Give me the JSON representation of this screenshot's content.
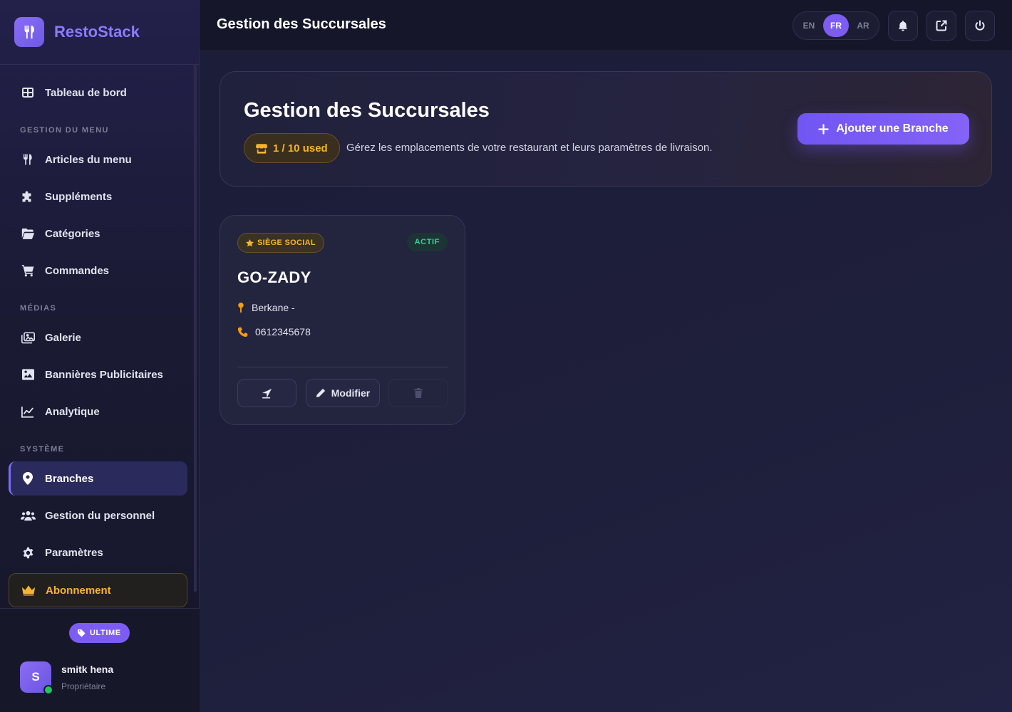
{
  "brand": {
    "name": "RestoStack",
    "icon": "utensils-icon"
  },
  "colors": {
    "accent": "#7c5cf3",
    "warning": "#f5b531",
    "success": "#2fd39a",
    "background": "#1c1d35"
  },
  "sidebar": {
    "dashboard": "Tableau de bord",
    "sections": {
      "menu": "GESTION DU MENU",
      "media": "MÉDIAS",
      "system": "SYSTÈME"
    },
    "items": {
      "menu_items": "Articles du menu",
      "supplements": "Suppléments",
      "categories": "Catégories",
      "orders": "Commandes",
      "gallery": "Galerie",
      "banners": "Bannières Publicitaires",
      "analytics": "Analytique",
      "branches": "Branches",
      "staff": "Gestion du personnel",
      "settings": "Paramètres",
      "subscription": "Abonnement"
    },
    "active": "branches"
  },
  "plan": {
    "label": "ULTIME"
  },
  "user": {
    "initial": "S",
    "name": "smitk hena",
    "role": "Propriétaire",
    "online": true
  },
  "topbar": {
    "title": "Gestion des Succursales",
    "languages": [
      "EN",
      "FR",
      "AR"
    ],
    "active_language": "FR"
  },
  "page": {
    "title": "Gestion des Succursales",
    "usage": "1 / 10 used",
    "description": "Gérez les emplacements de votre restaurant et leurs paramètres de livraison.",
    "add_button": "Ajouter une Branche"
  },
  "branches": [
    {
      "badge": "SIÈGE SOCIAL",
      "status": "ACTIF",
      "name": "GO-ZADY",
      "address": "Berkane -",
      "phone": "0612345678",
      "edit_label": "Modifier"
    }
  ]
}
